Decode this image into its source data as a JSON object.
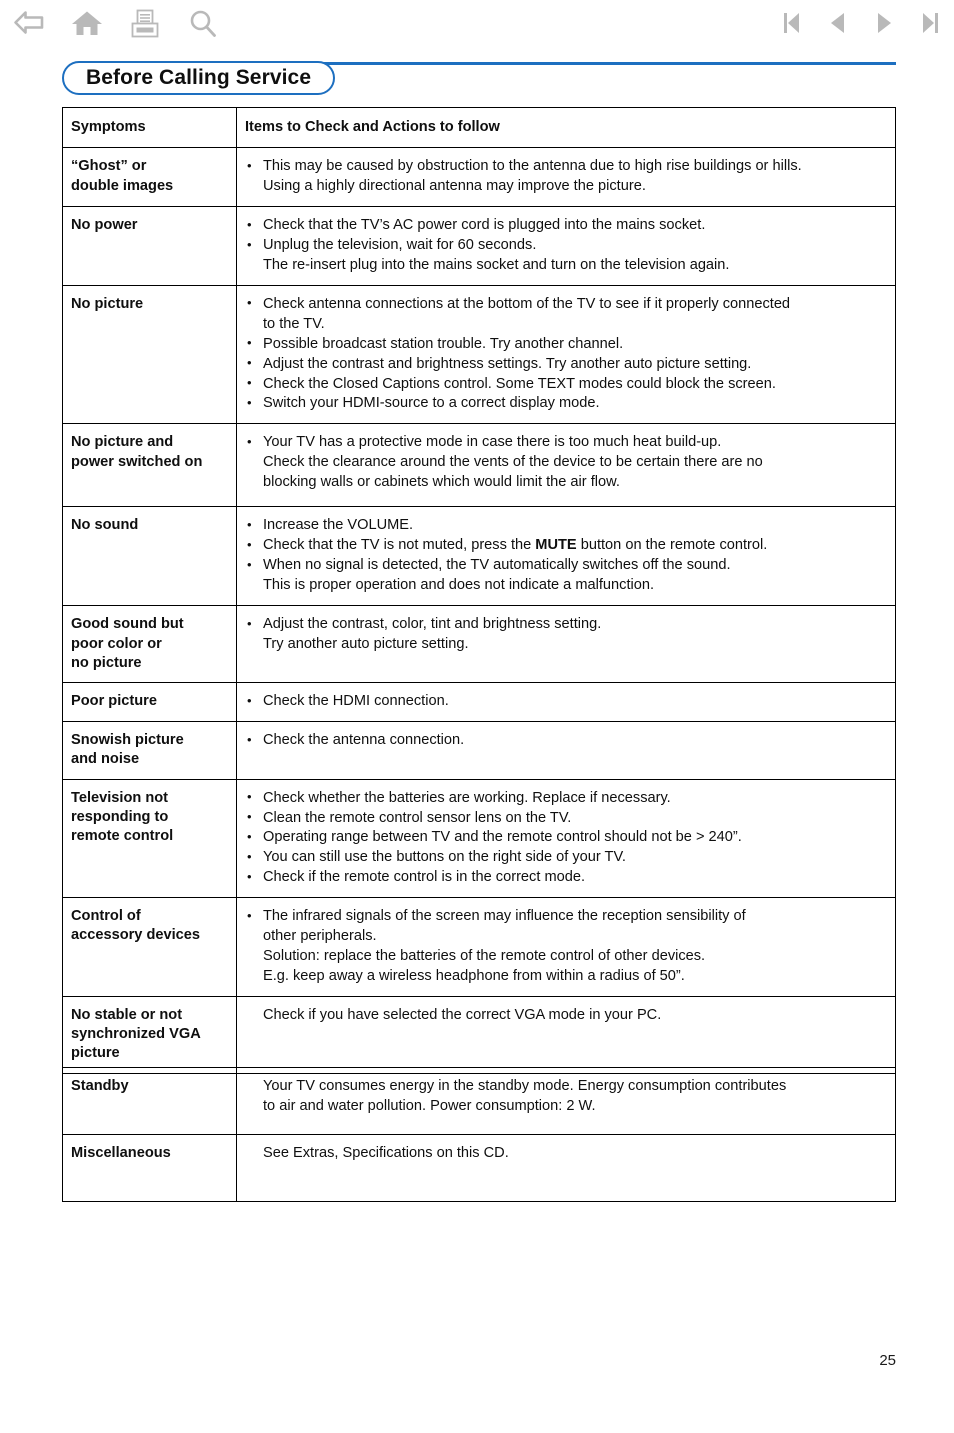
{
  "toolbar": {
    "left_icons": [
      {
        "name": "back-icon",
        "label": "Back"
      },
      {
        "name": "home-icon",
        "label": "Home"
      },
      {
        "name": "print-icon",
        "label": "Print"
      },
      {
        "name": "search-icon",
        "label": "Search"
      }
    ],
    "right_icons": [
      {
        "name": "first-page-icon",
        "label": "First page"
      },
      {
        "name": "previous-page-icon",
        "label": "Previous page"
      },
      {
        "name": "next-page-icon",
        "label": "Next page"
      },
      {
        "name": "last-page-icon",
        "label": "Last page"
      }
    ]
  },
  "colors": {
    "accent_blue": "#1d6fc0",
    "icon_gray": "#b3b3b3",
    "text": "#0f0f0f"
  },
  "title": "Before Calling Service",
  "page_number": "25",
  "table_main": {
    "header": {
      "symptoms": "Symptoms",
      "actions": "Items to Check and Actions to follow"
    },
    "rows": [
      {
        "symptom": "“Ghost” or\ndouble images",
        "items": [
          {
            "bullet": true,
            "text": "This may be caused by obstruction to the antenna due to high rise buildings or hills."
          },
          {
            "bullet": false,
            "text": "Using a highly directional antenna may improve the picture."
          }
        ]
      },
      {
        "symptom": "No power",
        "items": [
          {
            "bullet": true,
            "text": "Check that the TV’s AC power cord is plugged into the mains socket."
          },
          {
            "bullet": true,
            "text": "Unplug the television, wait for 60 seconds."
          },
          {
            "bullet": false,
            "text": "The re-insert plug into the mains socket and turn on the television again."
          }
        ]
      },
      {
        "symptom": "No picture",
        "items": [
          {
            "bullet": true,
            "text": "Check antenna connections at the bottom of the TV to see if it properly connected"
          },
          {
            "bullet": false,
            "text": "to the TV."
          },
          {
            "bullet": true,
            "text": "Possible broadcast station trouble. Try another channel."
          },
          {
            "bullet": true,
            "text": "Adjust the contrast and brightness settings. Try another auto picture setting."
          },
          {
            "bullet": true,
            "text": "Check the Closed Captions control. Some TEXT modes could block the screen."
          },
          {
            "bullet": true,
            "text": "Switch your HDMI-source to a correct display mode."
          }
        ]
      },
      {
        "symptom": "No picture and\npower switched on",
        "items": [
          {
            "bullet": true,
            "text": "Your TV has a protective mode in case there is too much heat build-up."
          },
          {
            "bullet": false,
            "text": "Check the clearance around the vents of the device to be certain there are no"
          },
          {
            "bullet": false,
            "text": "blocking walls or cabinets which would limit the air flow."
          }
        ]
      },
      {
        "symptom": "No sound",
        "items": [
          {
            "bullet": true,
            "text": "Increase the VOLUME."
          },
          {
            "bullet": true,
            "text": "Check that the TV is not muted, press the ",
            "bold": "MUTE",
            "text_after": " button on the remote control."
          },
          {
            "bullet": true,
            "text": "When no signal is detected, the TV automatically switches off the sound."
          },
          {
            "bullet": false,
            "text": "This is proper operation and does not indicate a malfunction."
          }
        ]
      },
      {
        "symptom": "Good sound but\npoor color or\nno picture",
        "items": [
          {
            "bullet": true,
            "text": "Adjust the contrast, color, tint and brightness setting."
          },
          {
            "bullet": false,
            "text": "Try another auto picture setting."
          }
        ]
      },
      {
        "symptom": "Poor picture",
        "items": [
          {
            "bullet": true,
            "text": "Check the HDMI connection."
          }
        ]
      },
      {
        "symptom": "Snowish picture\nand noise",
        "items": [
          {
            "bullet": true,
            "text": "Check the antenna connection."
          }
        ]
      },
      {
        "symptom": "Television not\nresponding to\nremote control",
        "items": [
          {
            "bullet": true,
            "text": "Check whether the batteries are working. Replace if necessary."
          },
          {
            "bullet": true,
            "text": "Clean the remote control sensor lens on the TV."
          },
          {
            "bullet": true,
            "text": "Operating range between TV and the remote control should not be > 240”."
          },
          {
            "bullet": true,
            "text": "You can still use the buttons on the right side of your TV."
          },
          {
            "bullet": true,
            "text": "Check if the remote control is in the correct mode."
          }
        ]
      },
      {
        "symptom": "Control of\naccessory devices",
        "items": [
          {
            "bullet": true,
            "text": "The infrared signals of the screen may influence the reception sensibility of"
          },
          {
            "bullet": false,
            "text": "other peripherals."
          },
          {
            "bullet": false,
            "text": "Solution: replace the batteries of the remote control of other devices."
          },
          {
            "bullet": false,
            "text": "E.g. keep away a wireless headphone from within a radius of 50”."
          }
        ]
      },
      {
        "symptom": "No stable or not\nsynchronized VGA\npicture",
        "items": [
          {
            "bullet": false,
            "plain": true,
            "text": "Check if you have selected the correct VGA mode in your PC."
          }
        ]
      }
    ]
  },
  "table_extra": {
    "rows": [
      {
        "symptom": "Standby",
        "items": [
          {
            "bullet": false,
            "plain": true,
            "text": "Your TV consumes energy in the standby mode. Energy consumption contributes"
          },
          {
            "bullet": false,
            "plain": true,
            "text": "to air and water pollution.  Power consumption: 2 W."
          }
        ]
      },
      {
        "symptom": "Miscellaneous",
        "items": [
          {
            "bullet": false,
            "plain": true,
            "text": "See Extras, Specifications on this CD."
          }
        ]
      }
    ]
  }
}
